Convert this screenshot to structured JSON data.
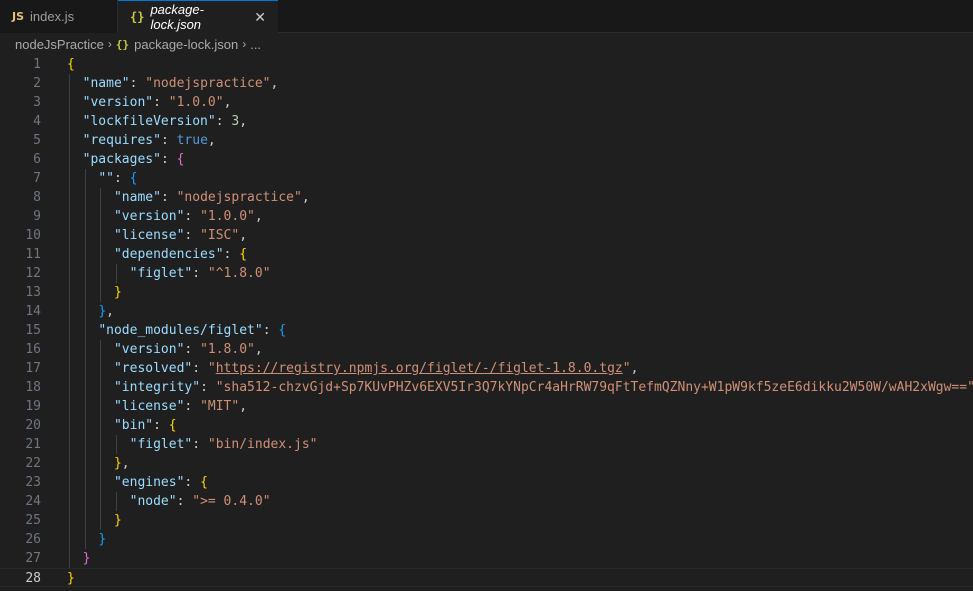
{
  "tabs": [
    {
      "icon": "JS",
      "label": "index.js",
      "active": false
    },
    {
      "icon": "{}",
      "label": "package-lock.json",
      "active": true,
      "close": "✕"
    }
  ],
  "breadcrumb": {
    "folder": "nodeJsPractice",
    "file_icon": "{}",
    "file": "package-lock.json",
    "more": "..."
  },
  "editor": {
    "current_line": 28,
    "lines": [
      {
        "n": "1",
        "indent": 0,
        "t": [
          [
            "b1",
            "{"
          ]
        ]
      },
      {
        "n": "2",
        "indent": 1,
        "t": [
          [
            "key",
            "\"name\""
          ],
          [
            "p",
            ": "
          ],
          [
            "str",
            "\"nodejspractice\""
          ],
          [
            "p",
            ","
          ]
        ]
      },
      {
        "n": "3",
        "indent": 1,
        "t": [
          [
            "key",
            "\"version\""
          ],
          [
            "p",
            ": "
          ],
          [
            "str",
            "\"1.0.0\""
          ],
          [
            "p",
            ","
          ]
        ]
      },
      {
        "n": "4",
        "indent": 1,
        "t": [
          [
            "key",
            "\"lockfileVersion\""
          ],
          [
            "p",
            ": "
          ],
          [
            "num",
            "3"
          ],
          [
            "p",
            ","
          ]
        ]
      },
      {
        "n": "5",
        "indent": 1,
        "t": [
          [
            "key",
            "\"requires\""
          ],
          [
            "p",
            ": "
          ],
          [
            "kw",
            "true"
          ],
          [
            "p",
            ","
          ]
        ]
      },
      {
        "n": "6",
        "indent": 1,
        "t": [
          [
            "key",
            "\"packages\""
          ],
          [
            "p",
            ": "
          ],
          [
            "b2",
            "{"
          ]
        ]
      },
      {
        "n": "7",
        "indent": 2,
        "t": [
          [
            "key",
            "\"\""
          ],
          [
            "p",
            ": "
          ],
          [
            "b3",
            "{"
          ]
        ]
      },
      {
        "n": "8",
        "indent": 3,
        "t": [
          [
            "key",
            "\"name\""
          ],
          [
            "p",
            ": "
          ],
          [
            "str",
            "\"nodejspractice\""
          ],
          [
            "p",
            ","
          ]
        ]
      },
      {
        "n": "9",
        "indent": 3,
        "t": [
          [
            "key",
            "\"version\""
          ],
          [
            "p",
            ": "
          ],
          [
            "str",
            "\"1.0.0\""
          ],
          [
            "p",
            ","
          ]
        ]
      },
      {
        "n": "10",
        "indent": 3,
        "t": [
          [
            "key",
            "\"license\""
          ],
          [
            "p",
            ": "
          ],
          [
            "str",
            "\"ISC\""
          ],
          [
            "p",
            ","
          ]
        ]
      },
      {
        "n": "11",
        "indent": 3,
        "t": [
          [
            "key",
            "\"dependencies\""
          ],
          [
            "p",
            ": "
          ],
          [
            "b1",
            "{"
          ]
        ]
      },
      {
        "n": "12",
        "indent": 4,
        "t": [
          [
            "key",
            "\"figlet\""
          ],
          [
            "p",
            ": "
          ],
          [
            "str",
            "\"^1.8.0\""
          ]
        ]
      },
      {
        "n": "13",
        "indent": 3,
        "t": [
          [
            "b1",
            "}"
          ]
        ]
      },
      {
        "n": "14",
        "indent": 2,
        "t": [
          [
            "b3",
            "}"
          ],
          [
            "p",
            ","
          ]
        ]
      },
      {
        "n": "15",
        "indent": 2,
        "t": [
          [
            "key",
            "\"node_modules/figlet\""
          ],
          [
            "p",
            ": "
          ],
          [
            "b3",
            "{"
          ]
        ]
      },
      {
        "n": "16",
        "indent": 3,
        "t": [
          [
            "key",
            "\"version\""
          ],
          [
            "p",
            ": "
          ],
          [
            "str",
            "\"1.8.0\""
          ],
          [
            "p",
            ","
          ]
        ]
      },
      {
        "n": "17",
        "indent": 3,
        "t": [
          [
            "key",
            "\"resolved\""
          ],
          [
            "p",
            ": "
          ],
          [
            "str",
            "\""
          ],
          [
            "link",
            "https://registry.npmjs.org/figlet/-/figlet-1.8.0.tgz"
          ],
          [
            "str",
            "\""
          ],
          [
            "p",
            ","
          ]
        ]
      },
      {
        "n": "18",
        "indent": 3,
        "t": [
          [
            "key",
            "\"integrity\""
          ],
          [
            "p",
            ": "
          ],
          [
            "str",
            "\"sha512-chzvGjd+Sp7KUvPHZv6EXV5Ir3Q7kYNpCr4aHrRW79qFtTefmQZNny+W1pW9kf5zeE6dikku2W50W/wAH2xWgw==\""
          ],
          [
            "p",
            ","
          ]
        ]
      },
      {
        "n": "19",
        "indent": 3,
        "t": [
          [
            "key",
            "\"license\""
          ],
          [
            "p",
            ": "
          ],
          [
            "str",
            "\"MIT\""
          ],
          [
            "p",
            ","
          ]
        ]
      },
      {
        "n": "20",
        "indent": 3,
        "t": [
          [
            "key",
            "\"bin\""
          ],
          [
            "p",
            ": "
          ],
          [
            "b1",
            "{"
          ]
        ]
      },
      {
        "n": "21",
        "indent": 4,
        "t": [
          [
            "key",
            "\"figlet\""
          ],
          [
            "p",
            ": "
          ],
          [
            "str",
            "\"bin/index.js\""
          ]
        ]
      },
      {
        "n": "22",
        "indent": 3,
        "t": [
          [
            "b1",
            "}"
          ],
          [
            "p",
            ","
          ]
        ]
      },
      {
        "n": "23",
        "indent": 3,
        "t": [
          [
            "key",
            "\"engines\""
          ],
          [
            "p",
            ": "
          ],
          [
            "b1",
            "{"
          ]
        ]
      },
      {
        "n": "24",
        "indent": 4,
        "t": [
          [
            "key",
            "\"node\""
          ],
          [
            "p",
            ": "
          ],
          [
            "str",
            "\">= 0.4.0\""
          ]
        ]
      },
      {
        "n": "25",
        "indent": 3,
        "t": [
          [
            "b1",
            "}"
          ]
        ]
      },
      {
        "n": "26",
        "indent": 2,
        "t": [
          [
            "b3",
            "}"
          ]
        ]
      },
      {
        "n": "27",
        "indent": 1,
        "t": [
          [
            "b2",
            "}"
          ]
        ]
      },
      {
        "n": "28",
        "indent": 0,
        "t": [
          [
            "b1",
            "}"
          ]
        ]
      }
    ]
  }
}
